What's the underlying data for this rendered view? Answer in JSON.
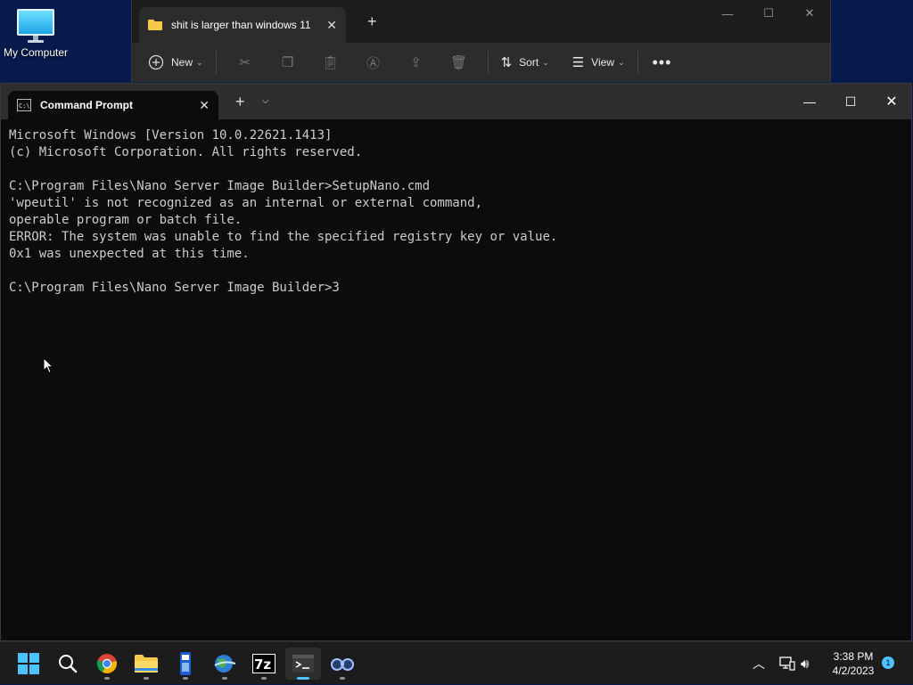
{
  "desktop": {
    "icon_label": "My Computer"
  },
  "explorer": {
    "tab_title": "shit is larger than windows 11",
    "toolbar": {
      "new_label": "New",
      "sort_label": "Sort",
      "view_label": "View"
    }
  },
  "terminal": {
    "tab_title": "Command Prompt",
    "lines": [
      "Microsoft Windows [Version 10.0.22621.1413]",
      "(c) Microsoft Corporation. All rights reserved.",
      "",
      "C:\\Program Files\\Nano Server Image Builder>SetupNano.cmd",
      "'wpeutil' is not recognized as an internal or external command,",
      "operable program or batch file.",
      "ERROR: The system was unable to find the specified registry key or value.",
      "0x1 was unexpected at this time.",
      "",
      "C:\\Program Files\\Nano Server Image Builder>3"
    ]
  },
  "taskbar": {
    "time": "3:38 PM",
    "date": "4/2/2023",
    "notification_count": "1",
    "apps": [
      "start-icon",
      "search-icon",
      "chrome-icon",
      "file-explorer-icon",
      "usb-tool-icon",
      "globe-app-icon",
      "7zip-icon",
      "terminal-icon",
      "binoculars-icon"
    ]
  },
  "colors": {
    "accent": "#4cc2ff",
    "desktop": "#071a4d",
    "console_bg": "#0c0c0c",
    "console_fg": "#cccccc"
  }
}
